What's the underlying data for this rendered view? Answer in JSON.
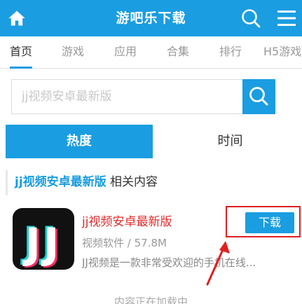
{
  "header": {
    "title": "游吧乐下载",
    "home_icon": "home-icon",
    "search_icon": "search-icon",
    "menu_icon": "menu-icon",
    "background_color": "#1a9de1"
  },
  "nav": {
    "tabs": [
      {
        "label": "首页",
        "active": true
      },
      {
        "label": "游戏",
        "active": false
      },
      {
        "label": "应用",
        "active": false
      },
      {
        "label": "合集",
        "active": false
      },
      {
        "label": "排行",
        "active": false
      },
      {
        "label": "H5游戏",
        "active": false
      }
    ]
  },
  "search": {
    "placeholder": "jj视频安卓最新版",
    "value": "",
    "submit_icon": "search-icon"
  },
  "sort": {
    "hot_label": "热度",
    "time_label": "时间",
    "active": "热度"
  },
  "section": {
    "keyword": "jj视频安卓最新版",
    "suffix": " 相关内容"
  },
  "results": [
    {
      "name": "jj视频安卓最新版",
      "category": "视频软件",
      "size": "57.8M",
      "meta": "视频软件 / 57.8M",
      "description": "JJ视频是一款非常受欢迎的手机在线...",
      "button_label": "下载",
      "icon_text": "JJ"
    }
  ],
  "loading_text": "内容正在加载中",
  "colors": {
    "accent": "#1a9de1",
    "highlight": "#e02020"
  }
}
